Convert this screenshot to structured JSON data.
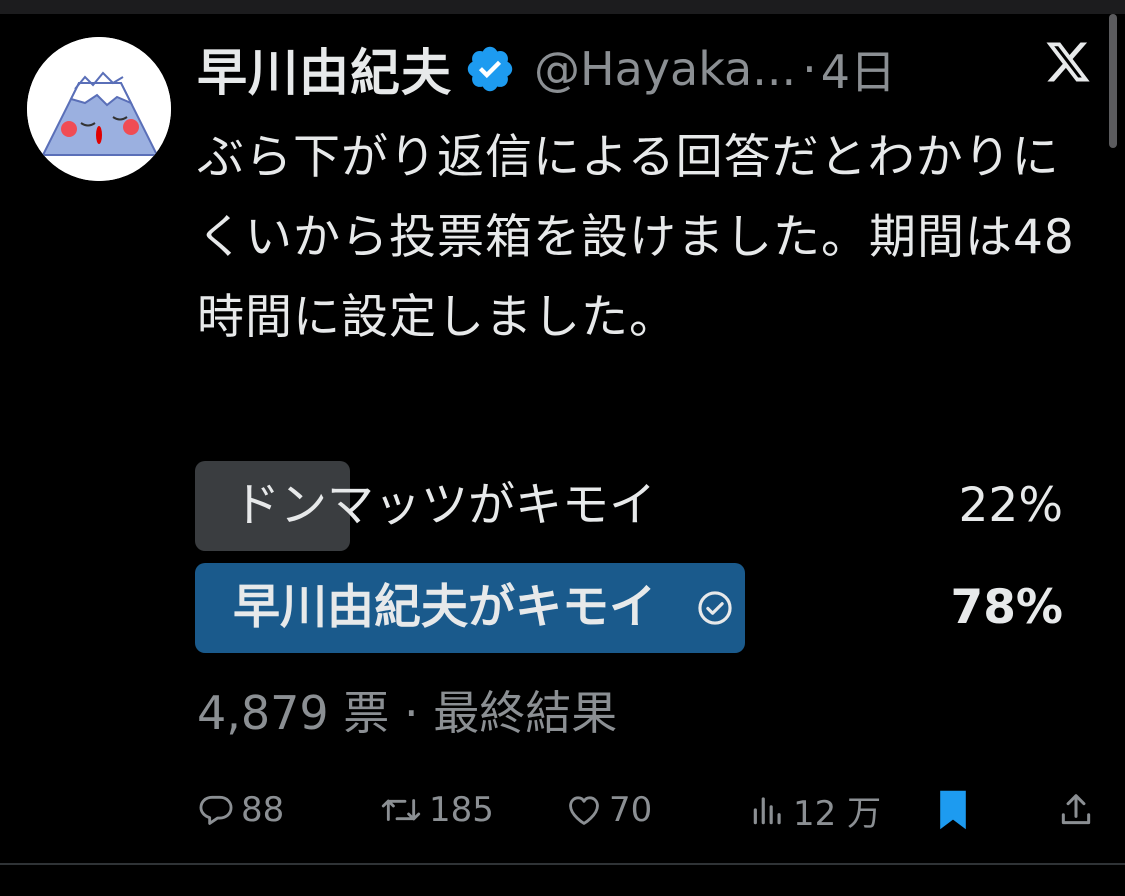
{
  "user": {
    "display_name": "早川由紀夫",
    "handle": "@Hayaka...",
    "time_sep": "·",
    "time": "4日",
    "avatar_icon": "mount-fuji-face-icon",
    "verified_icon": "verified-badge-icon",
    "verified_color": "#1d9bf0"
  },
  "tweet": {
    "text": "ぶら下がり返信による回答だとわかりにくいから投票箱を設けました。期間は48時間に設定しました。"
  },
  "poll": {
    "options": [
      {
        "label": "ドンマッツがキモイ",
        "percent_label": "22%",
        "percent": 22,
        "winner": false,
        "bar_color": "#3a3d40"
      },
      {
        "label": "早川由紀夫がキモイ",
        "percent_label": "78%",
        "percent": 78,
        "winner": true,
        "bar_color": "#1a5a8c"
      }
    ],
    "votes": "4,879 票",
    "meta_sep": "·",
    "status": "最終結果"
  },
  "actions": {
    "reply_count": "88",
    "retweet_count": "185",
    "like_count": "70",
    "views_count": "12 万",
    "bookmark_color": "#1d9bf0"
  },
  "colors": {
    "background": "#000000",
    "text": "#e7e9ea",
    "secondary": "#8b8f93"
  }
}
